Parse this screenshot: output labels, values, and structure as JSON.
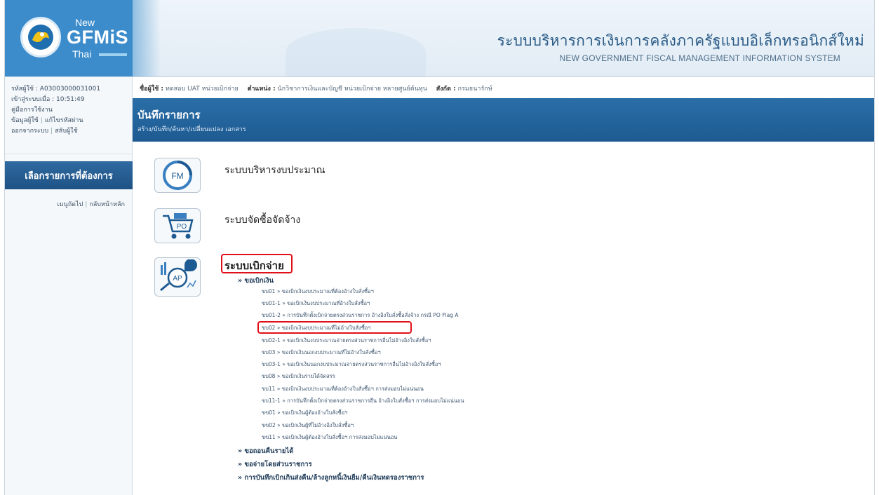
{
  "header": {
    "logo_new": "New",
    "logo_gfmis": "GFMiS",
    "logo_thai": "Thai",
    "title_th": "ระบบบริหารการเงินการคลังภาครัฐแบบอิเล็กทรอนิกส์ใหม่",
    "title_en": "NEW GOVERNMENT FISCAL MANAGEMENT INFORMATION SYSTEM"
  },
  "sidebar": {
    "user_label": "รหัสผู้ใช้ : A03003000031001",
    "login_time": "เข้าสู่ระบบเมื่อ : 10:51:49",
    "manual_link": "คู่มือการใช้งาน",
    "profile_link": "ข้อมูลผู้ใช้",
    "password_link": "แก้ไขรหัสผ่าน",
    "logout_link": "ออกจากระบบ",
    "switch_link": "สลับผู้ใช้",
    "menu_heading": "เลือกรายการที่ต้องการ",
    "next_menu_link": "เมนูถัดไป",
    "home_link": "กลับหน้าหลัก"
  },
  "userbar": {
    "name_label": "ชื่อผู้ใช้ :",
    "name_value": "ทดสอบ UAT หน่วยเบิกจ่าย",
    "position_label": "ตำแหน่ง :",
    "position_value": "นักวิชาการเงินและบัญชี หน่วยเบิกจ่าย หลายศูนย์ต้นทุน",
    "dept_label": "สังกัด :",
    "dept_value": "กรมธนารักษ์"
  },
  "banner": {
    "title": "บันทึกรายการ",
    "subtitle": "สร้าง/บันทึก/ค้นหา/เปลี่ยนแปลง เอกสาร"
  },
  "modules": {
    "fm": {
      "icon_text": "FM",
      "title": "ระบบบริหารงบประมาณ"
    },
    "po": {
      "icon_text": "PO",
      "title": "ระบบจัดซื้อจัดจ้าง"
    },
    "ap": {
      "icon_text": "AP",
      "title": "ระบบเบิกจ่าย"
    }
  },
  "ap_menu": {
    "group_withdraw": "» ขอเบิกเงิน",
    "items": [
      "ขบ01 » ขอเบิกเงินงบประมาณที่ต้องอ้างใบสั่งซื้อฯ",
      "ขบ01-1 » ขอเบิกเงินงบประมาณที่อ้างใบสั่งซื้อฯ",
      "ขบ01-2 » การบันทึกตั้งเบิกจ่ายตรงส่วนราชการ อ้างอิงใบสั่งซื้อสั่งจ้าง กรณี PO Flag A",
      "ขบ02 » ขอเบิกเงินงบประมาณที่ไม่อ้างใบสั่งซื้อฯ",
      "ขบ02-1 » ขอเบิกเงินงบประมาณจ่ายตรงส่วนราชการอื่นไม่อ้างอิงใบสั่งซื้อฯ",
      "ขบ03 » ขอเบิกเงินนอกงบประมาณที่ไม่อ้างใบสั่งซื้อฯ",
      "ขบ03-1 » ขอเบิกเงินนอกงบประมาณจ่ายตรงส่วนราชการอื่นไม่อ้างอิงใบสั่งซื้อฯ",
      "ขบ08 » ขอเบิกเงินรายได้จัดสรร",
      "ขบ11 » ขอเบิกเงินงบประมาณที่ต้องอ้างใบสั่งซื้อฯ การส่งมอบไม่แน่นอน",
      "ขบ11-1 » การบันทึกตั้งเบิกจ่ายตรงส่วนราชการอื่น อ้างอิงใบสั่งซื้อฯ การส่งมอบไม่แน่นอน",
      "ขข01 » ขอเบิกเงินผู้ต้องอ้างใบสั่งซื้อฯ",
      "ขข02 » ขอเบิกเงินผู้ที่ไม่อ้างอิงใบสั่งซื้อฯ",
      "ขข11 » ขอเบิกเงินผู้ต้องอ้างใบสั่งซื้อฯ การส่งมอบไม่แน่นอน"
    ],
    "group_refund": "» ขอถอนคืนรายได้",
    "group_gov_pay": "» ขอจ่ายโดยส่วนราชการ",
    "group_return": "» การบันทึกเบิกเกินส่งคืน/ล้างลูกหนี้เงินยืม/คืนเงินทดรองราชการ"
  },
  "colors": {
    "banner": "#1d5a91",
    "highlight": "#e0101a"
  }
}
